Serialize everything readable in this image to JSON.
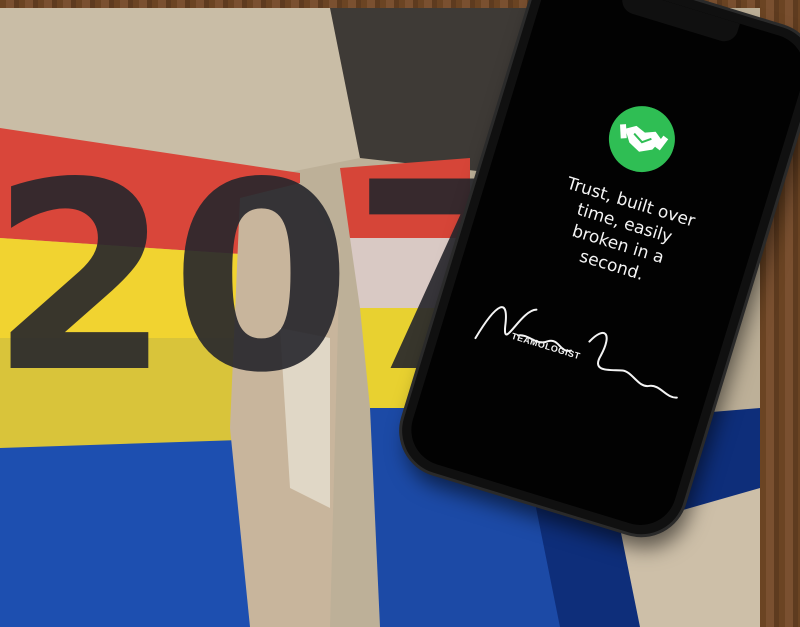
{
  "app": {
    "quote": "Trust, built over\ntime, easily\nbroken in a\nsecond.",
    "signature_label": "TEAMOLOGIST",
    "accent_color": "#2fbe54",
    "icon": "handshake-icon",
    "painted_digits": "207"
  }
}
